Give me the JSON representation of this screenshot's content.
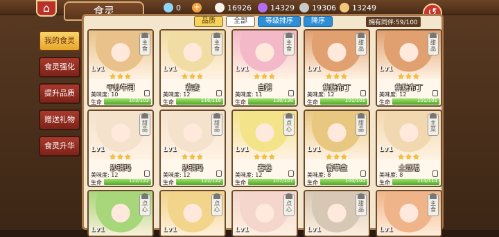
{
  "header": {
    "title": "食灵",
    "resources": [
      {
        "icon": "diamond-icon",
        "value": "0",
        "color": "#8fd6ff"
      },
      {
        "icon": "gourd-icon",
        "value": "16926",
        "color": "#f6f2e8"
      },
      {
        "icon": "crystal-icon",
        "value": "14329",
        "color": "#b46cf0"
      },
      {
        "icon": "coin-icon",
        "value": "19306",
        "color": "#c9c9c9"
      },
      {
        "icon": "food-icon",
        "value": "13249",
        "color": "#f1c77a"
      }
    ]
  },
  "toolbar": {
    "quality_label": "品质",
    "all_label": "全部",
    "sort_label": "等级排序",
    "order_label": "降序",
    "owned_text": "拥有同伴:59/100"
  },
  "side_menu": [
    {
      "label": "我的食灵",
      "active": true
    },
    {
      "label": "食灵强化",
      "active": false
    },
    {
      "label": "提升品质",
      "active": false
    },
    {
      "label": "赠送礼物",
      "active": false
    },
    {
      "label": "食灵升华",
      "active": false
    }
  ],
  "cards": [
    {
      "name": "干炒牛河",
      "level": "Lv1",
      "stars": "★★★",
      "taste": "美味度: 10",
      "hp_label": "生命",
      "hp": "103/103",
      "tag": "主食",
      "color": "#e8c28a",
      "hp_pct": 1.0
    },
    {
      "name": "燕麦",
      "level": "Lv1",
      "stars": "★★★",
      "taste": "美味度: 12",
      "hp_label": "生命",
      "hp": "116/116",
      "tag": "主食",
      "color": "#f1dca4",
      "hp_pct": 1.0
    },
    {
      "name": "白粥",
      "level": "Lv1",
      "stars": "★★★",
      "taste": "美味度: 11",
      "hp_label": "生命",
      "hp": "138/138",
      "tag": "主食",
      "color": "#f3b9c9",
      "hp_pct": 1.0
    },
    {
      "name": "焦糖布丁",
      "level": "Lv1",
      "stars": "★★★",
      "taste": "美味度: 12",
      "hp_label": "生命",
      "hp": "101/101",
      "tag": "甜品",
      "color": "#e0a070",
      "hp_pct": 1.0
    },
    {
      "name": "焦糖布丁",
      "level": "Lv1",
      "stars": "★★★",
      "taste": "美味度: 12",
      "hp_label": "生命",
      "hp": "101/101",
      "tag": "甜品",
      "color": "#e0a070",
      "hp_pct": 1.0
    },
    {
      "name": "沙琪玛",
      "level": "Lv1",
      "stars": "★★★",
      "taste": "美味度: 12",
      "hp_label": "生命",
      "hp": "122/122",
      "tag": "甜品",
      "color": "#f4e2cc",
      "hp_pct": 1.0
    },
    {
      "name": "沙琪玛",
      "level": "Lv1",
      "stars": "★★★",
      "taste": "美味度: 12",
      "hp_label": "生命",
      "hp": "122/122",
      "tag": "甜品",
      "color": "#f4e2cc",
      "hp_pct": 1.0
    },
    {
      "name": "春卷",
      "level": "Lv1",
      "stars": "★★★",
      "taste": "美味度: 12",
      "hp_label": "生命",
      "hp": "107/107",
      "tag": "点心",
      "color": "#f3e48a",
      "hp_pct": 1.0
    },
    {
      "name": "香草盒",
      "level": "Lv1",
      "stars": "★★★",
      "taste": "美味度: 8",
      "hp_label": "生命",
      "hp": "104/104",
      "tag": "甜品",
      "color": "#e8c880",
      "hp_pct": 1.0
    },
    {
      "name": "土豆泥",
      "level": "Lv1",
      "stars": "★★★",
      "taste": "美味度: 8",
      "hp_label": "生命",
      "hp": "114/114",
      "tag": "主菜",
      "color": "#f1d8b0",
      "hp_pct": 1.0
    },
    {
      "name": "",
      "level": "Lv1",
      "stars": "",
      "taste": "",
      "hp_label": "",
      "hp": "",
      "tag": "点心",
      "color": "#a8d67a",
      "hp_pct": 0
    },
    {
      "name": "",
      "level": "Lv1",
      "stars": "",
      "taste": "",
      "hp_label": "",
      "hp": "",
      "tag": "点心",
      "color": "#f2d48a",
      "hp_pct": 0
    },
    {
      "name": "",
      "level": "Lv1",
      "stars": "",
      "taste": "",
      "hp_label": "",
      "hp": "",
      "tag": "点心",
      "color": "#f4d6cc",
      "hp_pct": 0
    },
    {
      "name": "",
      "level": "Lv1",
      "stars": "",
      "taste": "",
      "hp_label": "",
      "hp": "",
      "tag": "甜品",
      "color": "#d6c8b4",
      "hp_pct": 0
    },
    {
      "name": "",
      "level": "Lv1",
      "stars": "",
      "taste": "",
      "hp_label": "",
      "hp": "",
      "tag": "主食",
      "color": "#f0b48a",
      "hp_pct": 0
    }
  ]
}
